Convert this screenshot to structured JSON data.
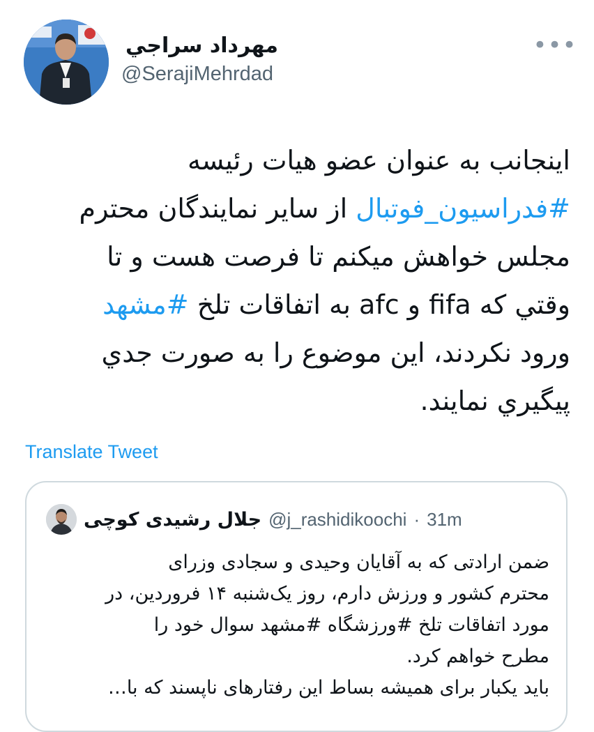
{
  "author": {
    "name": "مهرداد سراجي",
    "handle": "@SerajiMehrdad"
  },
  "more_icon": "more-horizontal-icon",
  "tweet": {
    "lines": [
      [
        "اینجانب به عنوان عضو هیات رئیسه"
      ],
      [
        "#فدراسیون_فوتبال",
        " از سایر نمایندگان محترم"
      ],
      [
        "مجلس خواهش میکنم تا فرصت هست و تا"
      ],
      [
        "وقتي كه fifa و afc به اتفاقات تلخ ",
        "#مشهد"
      ],
      [
        "ورود نكردند، اين موضوع را به صورت جدي"
      ],
      [
        "پيگيري نمايند."
      ]
    ],
    "hashtag_1": "#فدراسیون_فوتبال",
    "line_2_rest": " از سایر نمایندگان محترم",
    "line_1": "اینجانب به عنوان عضو هیات رئیسه",
    "line_3": "مجلس خواهش میکنم تا فرصت هست و تا",
    "line_4_text": "وقتي كه fifa و afc به اتفاقات تلخ ",
    "hashtag_2": "#مشهد",
    "line_5": "ورود نكردند، اين موضوع را به صورت جدي",
    "line_6": "پيگيري نمايند."
  },
  "translate_label": "Translate Tweet",
  "quote": {
    "name": "جلال رشیدی کوچی",
    "handle": "@j_rashidikoochi",
    "dot": "·",
    "time": "31m",
    "line_1": "ضمن ارادتی که به آقایان وحیدی و سجادی وزرای",
    "line_2": "محترم کشور و ورزش دارم، روز یک‌شنبه ۱۴ فروردین، در",
    "line_3": "مورد اتفاقات تلخ #ورزشگاه #مشهد سوال خود را",
    "line_4": "مطرح خواهم کرد.",
    "line_5": "باید یکبار برای همیشه بساط این رفتارهای ناپسند که با…"
  },
  "colors": {
    "accent": "#1d9bf0",
    "secondary_text": "#536471",
    "border": "#cfd9de"
  }
}
